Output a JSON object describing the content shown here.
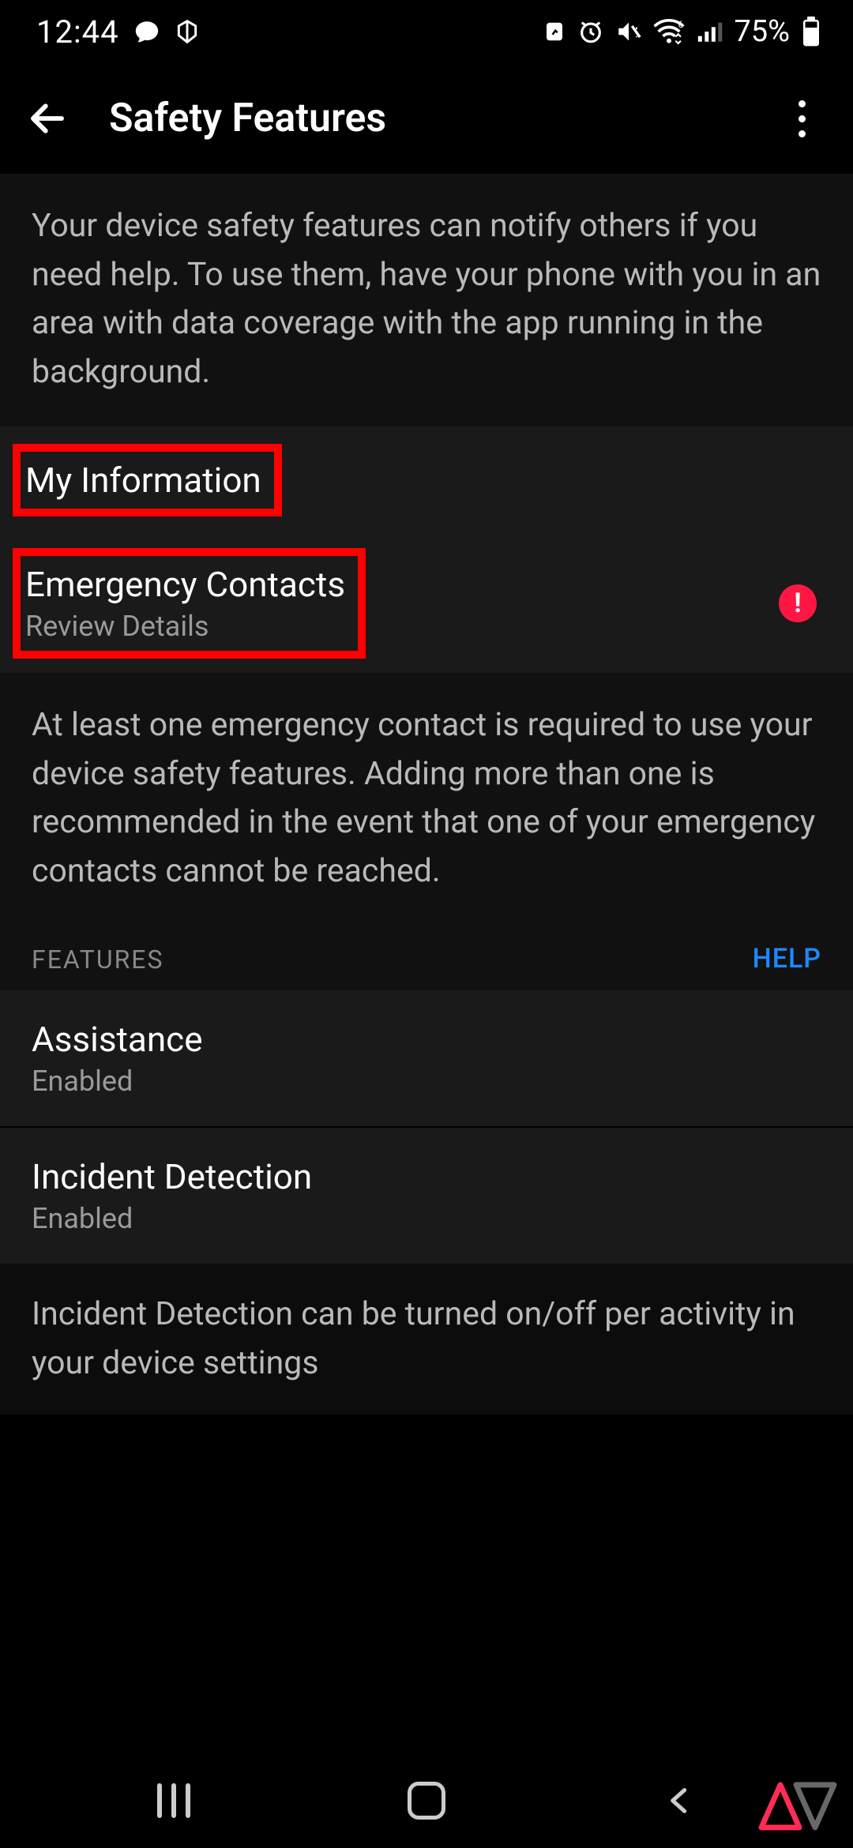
{
  "status": {
    "time": "12:44",
    "battery_text": "75%"
  },
  "header": {
    "title": "Safety Features"
  },
  "intro_text": "Your device safety features can notify others if you need help. To use them, have your phone with you in an area with data coverage with the app running in the background.",
  "list": {
    "my_info": {
      "title": "My Information"
    },
    "emergency_contacts": {
      "title": "Emergency Contacts",
      "sub": "Review Details"
    }
  },
  "contacts_note": "At least one emergency contact is required to use your device safety features. Adding more than one is recommended in the event that one of your emergency contacts cannot be reached.",
  "features_header": {
    "label": "FEATURES",
    "help": "HELP"
  },
  "features": {
    "assistance": {
      "title": "Assistance",
      "status": "Enabled"
    },
    "incident_detection": {
      "title": "Incident Detection",
      "status": "Enabled"
    }
  },
  "incident_note": "Incident Detection can be turned on/off per activity in your device settings",
  "alert_badge_char": "!",
  "watermark_label": "AP"
}
